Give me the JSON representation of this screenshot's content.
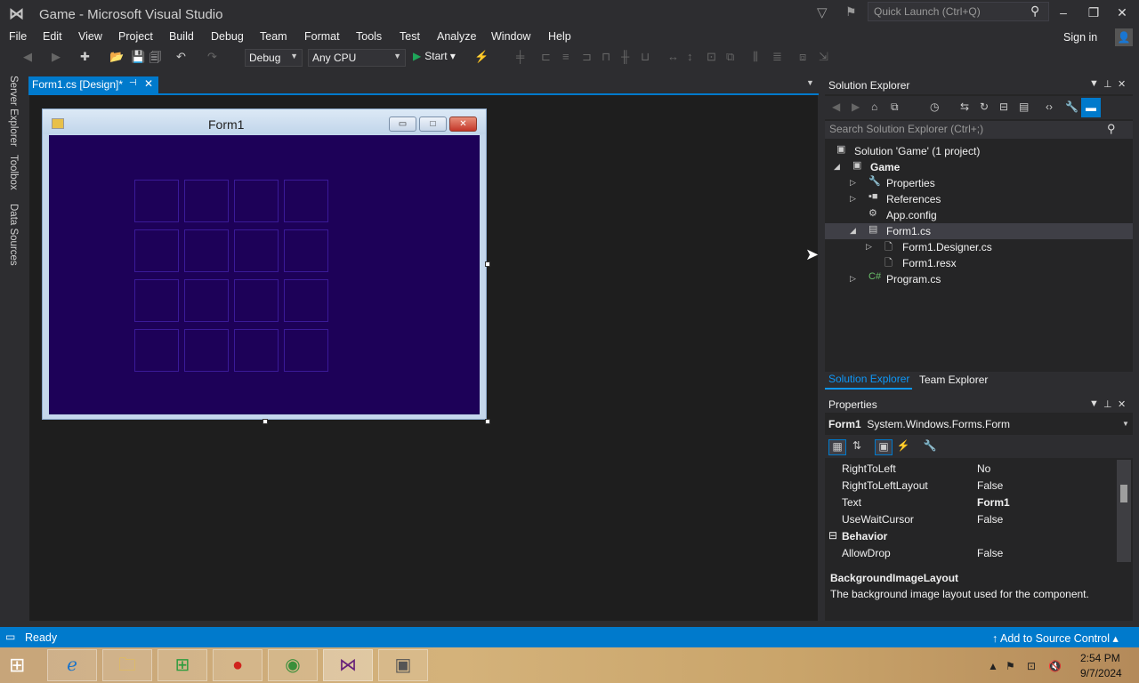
{
  "window": {
    "title": "Game - Microsoft Visual Studio"
  },
  "quick_launch": {
    "placeholder": "Quick Launch (Ctrl+Q)"
  },
  "menu": [
    "File",
    "Edit",
    "View",
    "Project",
    "Build",
    "Debug",
    "Team",
    "Format",
    "Tools",
    "Test",
    "Analyze",
    "Window",
    "Help"
  ],
  "account": {
    "signin": "Sign in"
  },
  "toolbar": {
    "config": "Debug",
    "platform": "Any CPU",
    "start": "Start"
  },
  "side_tabs": [
    "Server Explorer",
    "Toolbox",
    "Data Sources"
  ],
  "document": {
    "tab": "Form1.cs [Design]*"
  },
  "form": {
    "title": "Form1",
    "client_color": "#1d0158"
  },
  "solution_explorer": {
    "title": "Solution Explorer",
    "search_placeholder": "Search Solution Explorer (Ctrl+;)",
    "tree": {
      "solution": "Solution 'Game' (1 project)",
      "project": "Game",
      "properties": "Properties",
      "references": "References",
      "appconfig": "App.config",
      "form1": "Form1.cs",
      "designer": "Form1.Designer.cs",
      "resx": "Form1.resx",
      "program": "Program.cs"
    },
    "tabs": [
      "Solution Explorer",
      "Team Explorer"
    ]
  },
  "properties": {
    "title": "Properties",
    "object_name": "Form1",
    "object_type": "System.Windows.Forms.Form",
    "rows": [
      {
        "name": "RightToLeft",
        "value": "No"
      },
      {
        "name": "RightToLeftLayout",
        "value": "False"
      },
      {
        "name": "Text",
        "value": "Form1"
      },
      {
        "name": "UseWaitCursor",
        "value": "False"
      }
    ],
    "category": "Behavior",
    "rows2": [
      {
        "name": "AllowDrop",
        "value": "False"
      }
    ],
    "desc_title": "BackgroundImageLayout",
    "desc_text": "The background image layout used for the component."
  },
  "status": {
    "text": "Ready",
    "source_control": "Add to Source Control"
  },
  "clock": {
    "time": "2:54 PM",
    "date": "9/7/2024"
  },
  "colors": {
    "accent": "#007acc",
    "form_bg": "#1d0158"
  }
}
